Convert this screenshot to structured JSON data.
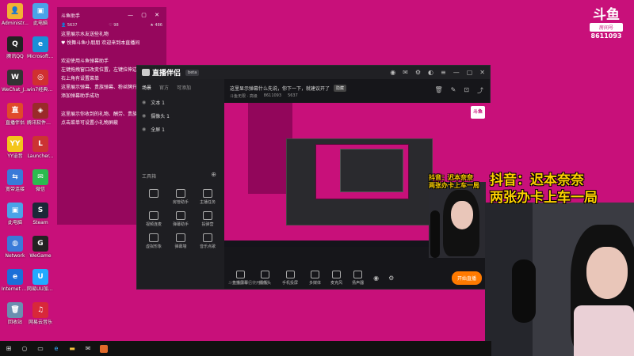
{
  "desktop_icons": [
    {
      "label": "Administr...",
      "color": "#f2b233",
      "glyph": "👤"
    },
    {
      "label": "此电脑",
      "color": "#4aa3e8",
      "glyph": "▣"
    },
    {
      "label": "腾讯QQ",
      "color": "#222",
      "glyph": "Q"
    },
    {
      "label": "Microsoft Edge",
      "color": "#1a8fd8",
      "glyph": "e"
    },
    {
      "label": "WeChat_J...",
      "color": "#333",
      "glyph": "W"
    },
    {
      "label": "win7经典开始菜单工具",
      "color": "#d03030",
      "glyph": "◎"
    },
    {
      "label": "直播伴侣",
      "color": "#e04a2a",
      "glyph": "直"
    },
    {
      "label": "腾讯软件以及驱动",
      "color": "#9a2a2a",
      "glyph": "◈"
    },
    {
      "label": "YY语音",
      "color": "#f3c51a",
      "glyph": "YY"
    },
    {
      "label": "Launcher...",
      "color": "#cc3333",
      "glyph": "L"
    },
    {
      "label": "宽带连接",
      "color": "#3a7ad8",
      "glyph": "⇆"
    },
    {
      "label": "微信",
      "color": "#2cbb4f",
      "glyph": "✉"
    },
    {
      "label": "此电脑",
      "color": "#4aa3e8",
      "glyph": "▣"
    },
    {
      "label": "Steam",
      "color": "#1b2838",
      "glyph": "S"
    },
    {
      "label": "Network",
      "color": "#3a7ad8",
      "glyph": "◍"
    },
    {
      "label": "WeGame",
      "color": "#222",
      "glyph": "G"
    },
    {
      "label": "Internet Explorer",
      "color": "#1b6fd8",
      "glyph": "e"
    },
    {
      "label": "网易UU加速器",
      "color": "#22aaff",
      "glyph": "U"
    },
    {
      "label": "回收站",
      "color": "#6a8fb0",
      "glyph": "🗑"
    },
    {
      "label": "网易云音乐",
      "color": "#d8283a",
      "glyph": "♫"
    }
  ],
  "overlay": {
    "title": "斗鱼助手",
    "stats": [
      "👤 5637",
      "♡ 98",
      "★ 486"
    ],
    "lines": [
      "这里展示水友送些礼物",
      "♥ 悦舞斗鱼小朋朋 欢迎来到本直播间",
      "欢迎使用斗鱼弹幕助手",
      "左键拖拽窗口改变位置，左键拉伸边框改变大小",
      "右上角有设置菜单",
      "这里展示弹幕、贵族弹幕、粉丝牌升级等",
      "添加弹幕助手成功",
      "这里展示你收到的礼物、酬劳、贵族开通",
      "点击菜单可设置小礼物屏蔽"
    ]
  },
  "app": {
    "name": "直播伴侣",
    "version": "beta",
    "left_tabs": [
      "场景",
      "官方",
      "可添加"
    ],
    "scenes": [
      "文本 1",
      "摄像头 1",
      "全屏 1"
    ],
    "tools_label": "工具箱",
    "tools": [
      "",
      "房管助手",
      "主播任务",
      "视频连麦",
      "弹幕助手",
      "投弹营",
      "虚拟形象",
      "弹幕墙",
      "音乐点歌"
    ],
    "notice": "这里显示弹幕什么先说，你下一下，就建议开了",
    "notice_chip": "隐藏",
    "meta": [
      "斗鱼无限 · 高级",
      "8611093",
      "5637"
    ],
    "bottom": [
      "直播屏幕",
      "摄像头",
      "手机投屏",
      "多媒体"
    ],
    "mic_label": "麦克风",
    "speaker_label": "扬声器",
    "golive": "开始直播",
    "footnote": "斗鱼直播伴侣使用教程"
  },
  "stream_overlay": {
    "small_caption_1": "抖音：迟本奈奈",
    "small_caption_2": "两张办卡上车一局",
    "big_caption_1": "抖音：迟本奈奈",
    "big_caption_2": "两张办卡上车一局"
  },
  "room": {
    "logo": "斗鱼",
    "label": "房间号",
    "number": "8611093"
  }
}
